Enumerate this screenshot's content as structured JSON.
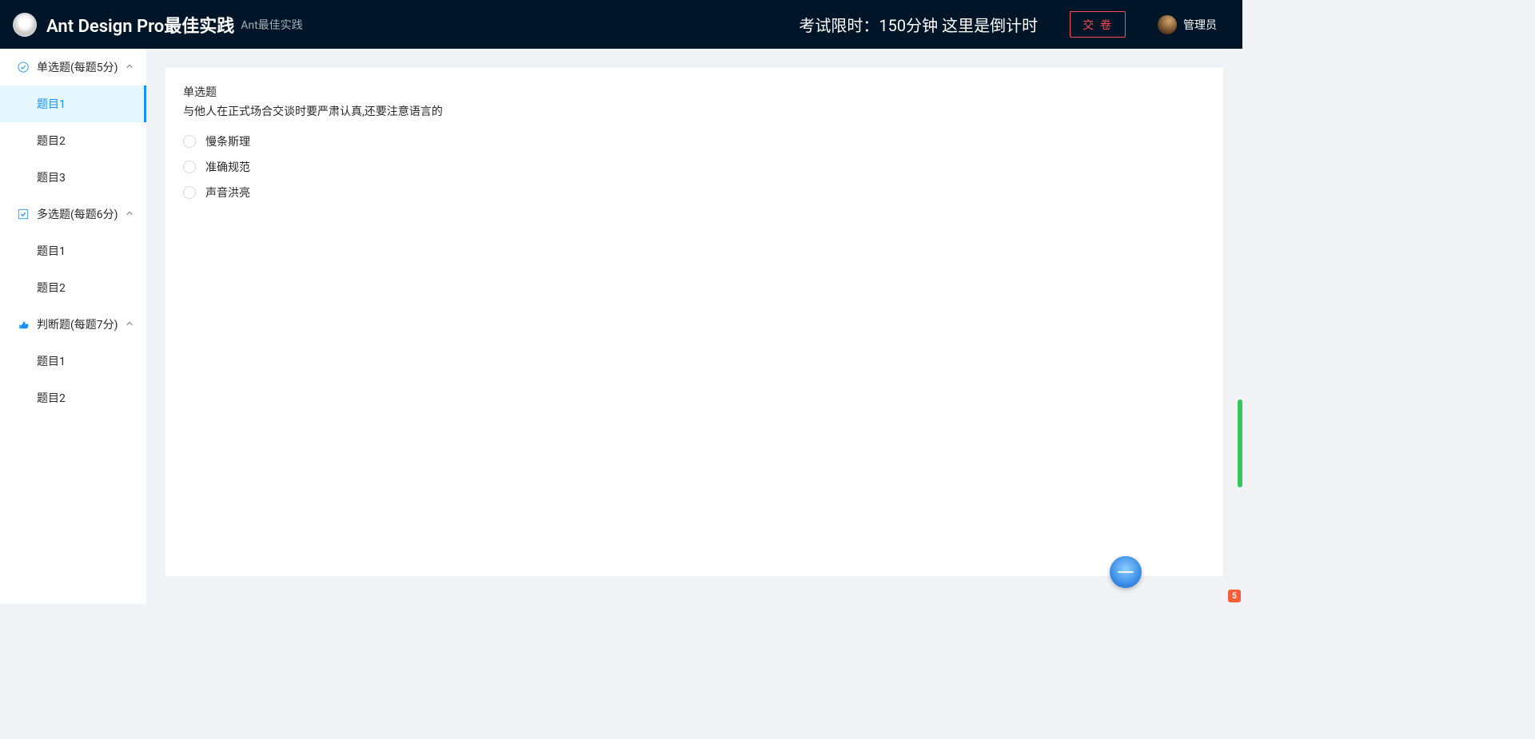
{
  "header": {
    "app_title": "Ant Design Pro最佳实践",
    "app_subtitle": "Ant最佳实践",
    "exam_timer": "考试限时：150分钟 这里是倒计时",
    "submit_label": "交 卷",
    "user_name": "管理员"
  },
  "sidebar": {
    "groups": [
      {
        "icon": "check-circle-icon",
        "title": "单选题(每题5分)",
        "expanded": true,
        "items": [
          {
            "label": "题目1",
            "selected": true
          },
          {
            "label": "题目2",
            "selected": false
          },
          {
            "label": "题目3",
            "selected": false
          }
        ]
      },
      {
        "icon": "check-square-icon",
        "title": "多选题(每题6分)",
        "expanded": true,
        "items": [
          {
            "label": "题目1",
            "selected": false
          },
          {
            "label": "题目2",
            "selected": false
          }
        ]
      },
      {
        "icon": "thumbs-up-icon",
        "title": "判断题(每题7分)",
        "expanded": true,
        "items": [
          {
            "label": "题目1",
            "selected": false
          },
          {
            "label": "题目2",
            "selected": false
          }
        ]
      }
    ]
  },
  "question": {
    "type_label": "单选题",
    "text": "与他人在正式场合交谈时要严肃认真,还要注意语言的",
    "options": [
      {
        "label": "慢条斯理"
      },
      {
        "label": "准确规范"
      },
      {
        "label": "声音洪亮"
      }
    ]
  },
  "corner_badge": {
    "text": "5"
  }
}
